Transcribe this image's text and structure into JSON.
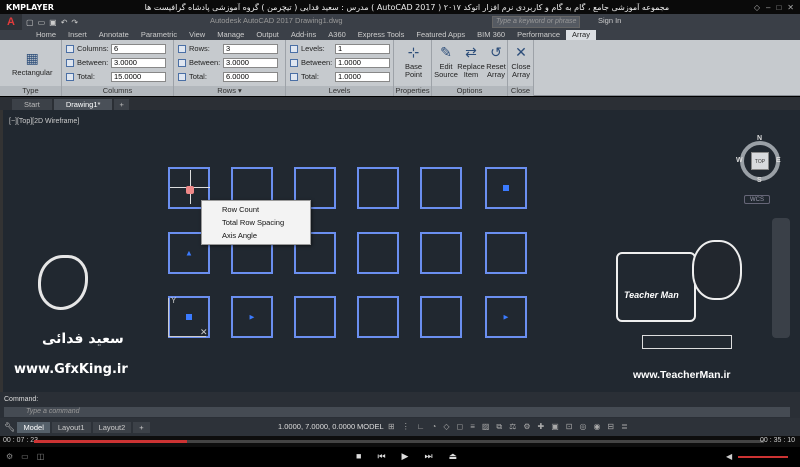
{
  "player": {
    "logo": "KMPLAYER",
    "title": "مجموعه آموزشی جامع ، گام به گام و کاربردی نرم افزار اتوکد ۲۰۱۷ ( AutoCAD 2017 ) مدرس : سعید فدایی ( تیچرمن ) گروه آموزشی پادشاه گرافیست ها",
    "time_elapsed": "00 : 07 : 23",
    "time_total": "00 : 35 : 10",
    "progress": 0.21
  },
  "acad": {
    "doc_title": "Autodesk AutoCAD 2017    Drawing1.dwg",
    "search_placeholder": "Type a keyword or phrase",
    "signin_label": "Sign In",
    "ribbon_tabs": [
      "Home",
      "Insert",
      "Annotate",
      "Parametric",
      "View",
      "Manage",
      "Output",
      "Add-ins",
      "A360",
      "Express Tools",
      "Featured Apps",
      "BIM 360",
      "Performance",
      "Array"
    ],
    "active_tab": "Array",
    "type_panel": {
      "button": "Rectangular",
      "label": "Type"
    },
    "columns_panel": {
      "label": "Columns",
      "fields": [
        {
          "label": "Columns:",
          "value": "6"
        },
        {
          "label": "Between:",
          "value": "3.0000"
        },
        {
          "label": "Total:",
          "value": "15.0000"
        }
      ]
    },
    "rows_panel": {
      "label": "Rows ▾",
      "fields": [
        {
          "label": "Rows:",
          "value": "3"
        },
        {
          "label": "Between:",
          "value": "3.0000"
        },
        {
          "label": "Total:",
          "value": "6.0000"
        }
      ]
    },
    "levels_panel": {
      "label": "Levels",
      "fields": [
        {
          "label": "Levels:",
          "value": "1"
        },
        {
          "label": "Between:",
          "value": "1.0000"
        },
        {
          "label": "Total:",
          "value": "1.0000"
        }
      ]
    },
    "properties_panel": {
      "button": "Base Point",
      "label": "Properties"
    },
    "options_panel": {
      "label": "Options",
      "buttons": [
        "Edit Source",
        "Replace Item",
        "Reset Array"
      ]
    },
    "close_panel": {
      "button": "Close Array",
      "label": "Close"
    },
    "doc_tabs": [
      "Start",
      "Drawing1*",
      "+"
    ],
    "viewport_label": "[−][Top][2D Wireframe]",
    "context_menu": [
      "Row Count",
      "Total Row Spacing",
      "Axis Angle"
    ],
    "viewcube": {
      "top": "TOP",
      "n": "N",
      "s": "S",
      "e": "E",
      "w": "W",
      "wcs": "WCS"
    },
    "command_history": "Command:",
    "command_placeholder": "Type a command",
    "layout_tabs": [
      "Model",
      "Layout1",
      "Layout2",
      "+"
    ],
    "coordinates": "1.0000, 7.0000, 0.0000",
    "mode": "MODEL"
  },
  "watermarks": {
    "left_name": "سعید فدائی",
    "left_url": "www.GfxKing.ir",
    "right_brand": "Teacher Man",
    "right_url": "www.TeacherMan.ir"
  },
  "colors": {
    "grid_box": "#6b8ff0",
    "marker": "#3b7bff",
    "drawing_bg": "#212830",
    "seek": "#cc3333"
  }
}
